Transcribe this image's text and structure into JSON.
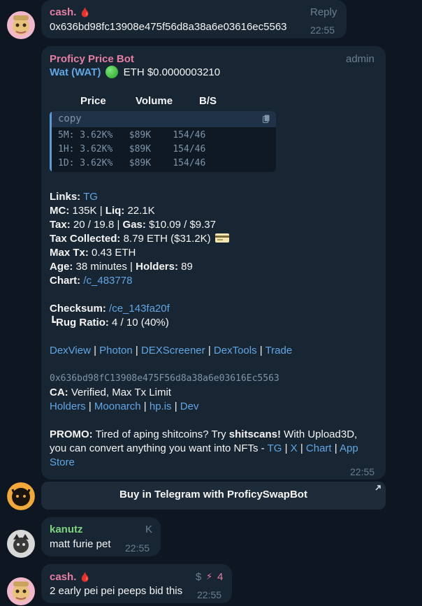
{
  "messages": [
    {
      "sender": "cash.",
      "sender_emoji": "🩸",
      "text": "0x636bd98fc13908e475f56d8a38a6e03616ec5563",
      "reply_label": "Reply",
      "time": "22:55"
    },
    {
      "sender": "Proficy Price Bot",
      "role": "admin",
      "token_line": {
        "name": "Wat (WAT)",
        "chain": "ETH",
        "price": "$0.0000003210"
      },
      "table_headers": [
        "Price",
        "Volume",
        "B/S"
      ],
      "code": {
        "copy_label": "copy",
        "rows": [
          "5M: 3.62K%   $89K    154/46",
          "1H: 3.62K%   $89K    154/46",
          "1D: 3.62K%   $89K    154/46"
        ]
      },
      "links_label": "Links:",
      "links_value": "TG",
      "mc_label": "MC:",
      "mc_value": "135K",
      "liq_label": "Liq:",
      "liq_value": "22.1K",
      "tax_label": "Tax:",
      "tax_value": "20 / 19.8",
      "gas_label": "Gas:",
      "gas_value": "$10.09 / $9.37",
      "taxcol_label": "Tax Collected:",
      "taxcol_value": "8.79 ETH ($31.2K)",
      "maxtx_label": "Max Tx:",
      "maxtx_value": "0.43 ETH",
      "age_label": "Age:",
      "age_value": "38 minutes",
      "holders_label": "Holders:",
      "holders_value": "89",
      "chart_label": "Chart:",
      "chart_value": "/c_483778",
      "checksum_label": "Checksum:",
      "checksum_value": "/ce_143fa20f",
      "rug_prefix": "┗",
      "rug_label": "Rug Ratio:",
      "rug_value": "4 / 10 (40%)",
      "dex_links": [
        "DexView",
        "Photon",
        "DEXScreener",
        "DexTools",
        "Trade"
      ],
      "ca_address": "0x636bd98fC13908e475F56d8a38a6e03616Ec5563",
      "ca_label": "CA:",
      "ca_value": "Verified, Max Tx Limit",
      "ca_links": [
        "Holders",
        "Moonarch",
        "hp.is",
        "Dev"
      ],
      "promo_label": "PROMO:",
      "promo_text_1": "Tired of aping shitcoins? Try",
      "promo_bold": "shitscans!",
      "promo_text_2": "With Upload3D,",
      "promo_text_3": "you can convert anything you want into NFTs -",
      "promo_links": [
        "TG",
        "X",
        "Chart",
        "App",
        "Store"
      ],
      "time": "22:55",
      "button_label": "Buy in Telegram with ProficySwapBot"
    },
    {
      "sender": "kanutz",
      "badge": "K",
      "text": "matt furie pet",
      "time": "22:55"
    },
    {
      "sender": "cash.",
      "sender_emoji": "🩸",
      "text": "2 early pei pei peeps bid this",
      "badge_dollar": "$",
      "badge_icon": "⚡",
      "badge_count": "4",
      "time": "22:55"
    }
  ],
  "colors": {
    "background": "#0e1621",
    "bubble": "#182533",
    "pink_name": "#e67fa3",
    "green_name": "#7fd47f",
    "link": "#62a6e4",
    "muted": "#6d7f8f"
  }
}
